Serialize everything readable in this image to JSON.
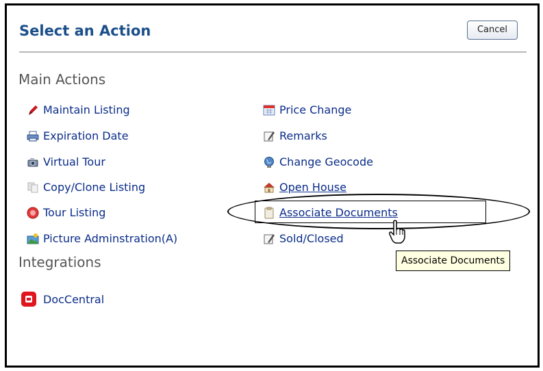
{
  "dialog": {
    "title": "Select an Action",
    "cancel_label": "Cancel"
  },
  "main_actions": {
    "heading": "Main Actions",
    "left": [
      {
        "label": "Maintain Listing",
        "icon": "pencil-icon"
      },
      {
        "label": "Expiration Date",
        "icon": "printer-icon"
      },
      {
        "label": "Virtual Tour",
        "icon": "camera-icon"
      },
      {
        "label": "Copy/Clone Listing",
        "icon": "copy-icon"
      },
      {
        "label": "Tour Listing",
        "icon": "tour-icon"
      },
      {
        "label": "Picture Adminstration(A)",
        "icon": "picture-icon"
      }
    ],
    "right": [
      {
        "label": "Price Change",
        "icon": "calendar-icon"
      },
      {
        "label": "Remarks",
        "icon": "note-icon"
      },
      {
        "label": "Change Geocode",
        "icon": "globe-icon"
      },
      {
        "label": "Open House",
        "icon": "house-icon"
      },
      {
        "label": "Associate Documents",
        "icon": "clipboard-icon"
      },
      {
        "label": "Sold/Closed",
        "icon": "note-icon"
      }
    ]
  },
  "integrations": {
    "heading": "Integrations",
    "items": [
      {
        "label": "DocCentral",
        "icon": "doccentral-icon"
      }
    ]
  },
  "tooltip": "Associate Documents",
  "colors": {
    "title": "#1b4f8a",
    "link": "#0a2c8a",
    "section": "#555555",
    "tooltip_bg": "#ffffe1"
  }
}
